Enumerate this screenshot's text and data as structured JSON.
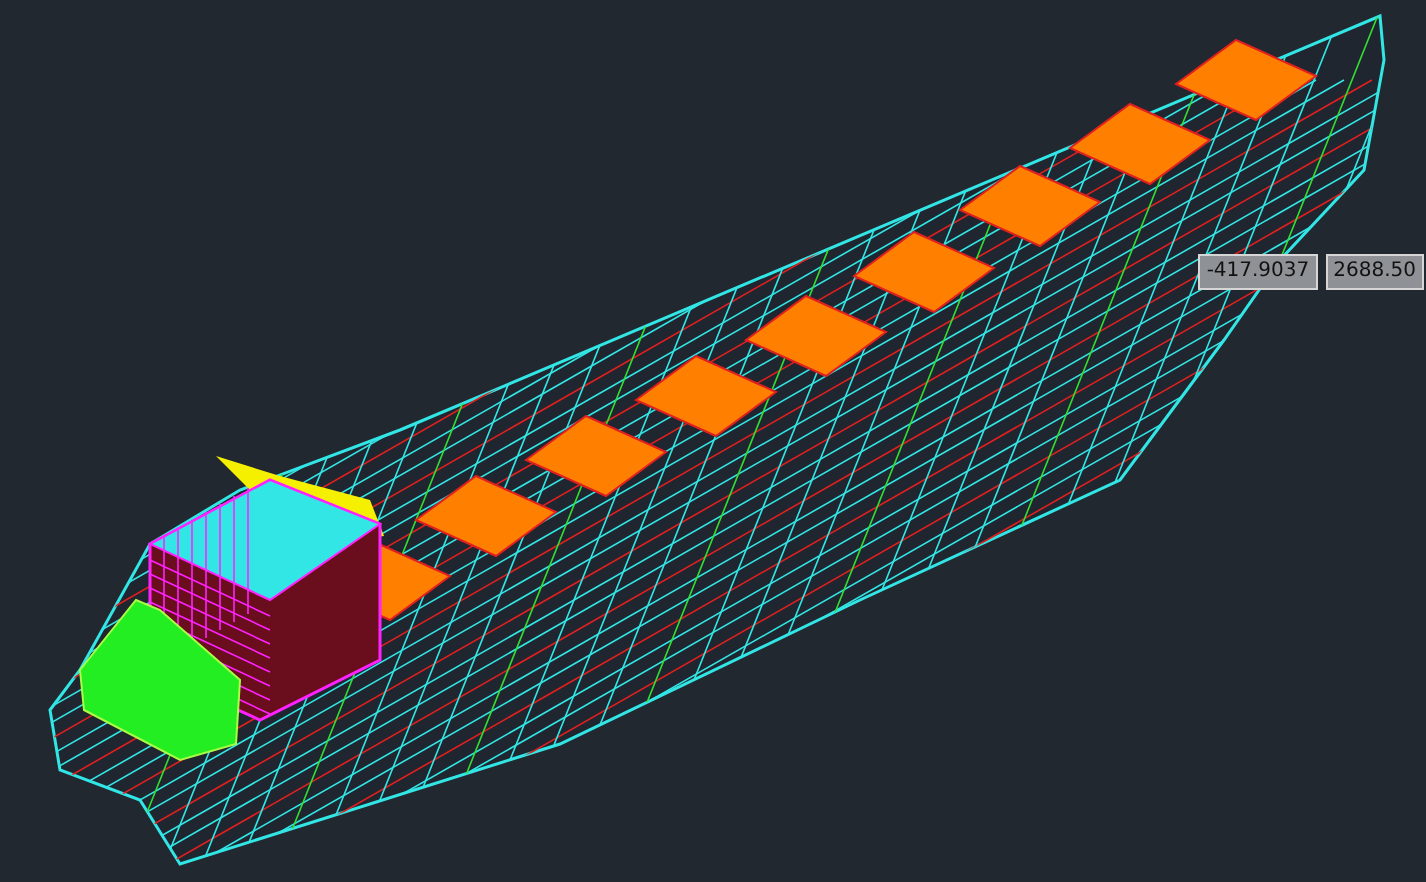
{
  "viewport": {
    "coordinate_input": {
      "x_value": "-417.9037",
      "y_value": "2688.50"
    }
  }
}
